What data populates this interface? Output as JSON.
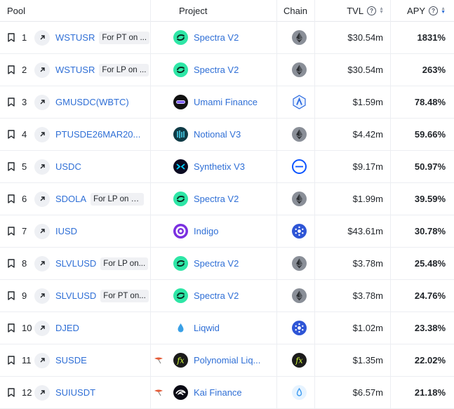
{
  "columns": {
    "pool": "Pool",
    "project": "Project",
    "chain": "Chain",
    "tvl": "TVL",
    "apy": "APY"
  },
  "icons": {
    "help": "question-circle-icon",
    "sort": "sort-arrows-icon",
    "bookmark": "bookmark-icon",
    "open": "arrow-up-right-icon"
  },
  "rows": [
    {
      "idx": "1",
      "symbol": "WSTUSR",
      "tag": "For PT on ...",
      "project": "Spectra V2",
      "project_icon": "spectra",
      "chain": "ethereum",
      "tvl": "$30.54m",
      "apy": "1831%",
      "kite": false
    },
    {
      "idx": "2",
      "symbol": "WSTUSR",
      "tag": "For LP on ...",
      "project": "Spectra V2",
      "project_icon": "spectra",
      "chain": "ethereum",
      "tvl": "$30.54m",
      "apy": "263%",
      "kite": false
    },
    {
      "idx": "3",
      "symbol": "GMUSDC(WBTC)",
      "tag": "",
      "project": "Umami Finance",
      "project_icon": "umami",
      "chain": "arbitrum",
      "tvl": "$1.59m",
      "apy": "78.48%",
      "kite": false
    },
    {
      "idx": "4",
      "symbol": "PTUSDE26MAR20...",
      "tag": "",
      "project": "Notional V3",
      "project_icon": "notional",
      "chain": "ethereum",
      "tvl": "$4.42m",
      "apy": "59.66%",
      "kite": false
    },
    {
      "idx": "5",
      "symbol": "USDC",
      "tag": "",
      "project": "Synthetix V3",
      "project_icon": "synthetix",
      "chain": "base",
      "tvl": "$9.17m",
      "apy": "50.97%",
      "kite": false
    },
    {
      "idx": "6",
      "symbol": "SDOLA",
      "tag": "For LP on In...",
      "project": "Spectra V2",
      "project_icon": "spectra",
      "chain": "ethereum",
      "tvl": "$1.99m",
      "apy": "39.59%",
      "kite": false
    },
    {
      "idx": "7",
      "symbol": "IUSD",
      "tag": "",
      "project": "Indigo",
      "project_icon": "indigo",
      "chain": "cardano",
      "tvl": "$43.61m",
      "apy": "30.78%",
      "kite": false
    },
    {
      "idx": "8",
      "symbol": "SLVLUSD",
      "tag": "For LP on...",
      "project": "Spectra V2",
      "project_icon": "spectra",
      "chain": "ethereum",
      "tvl": "$3.78m",
      "apy": "25.48%",
      "kite": false
    },
    {
      "idx": "9",
      "symbol": "SLVLUSD",
      "tag": "For PT on...",
      "project": "Spectra V2",
      "project_icon": "spectra",
      "chain": "ethereum",
      "tvl": "$3.78m",
      "apy": "24.76%",
      "kite": false
    },
    {
      "idx": "10",
      "symbol": "DJED",
      "tag": "",
      "project": "Liqwid",
      "project_icon": "liqwid",
      "chain": "cardano",
      "tvl": "$1.02m",
      "apy": "23.38%",
      "kite": false
    },
    {
      "idx": "11",
      "symbol": "SUSDE",
      "tag": "",
      "project": "Polynomial Liq...",
      "project_icon": "polynomial",
      "chain": "polynomial",
      "tvl": "$1.35m",
      "apy": "22.02%",
      "kite": true
    },
    {
      "idx": "12",
      "symbol": "SUIUSDT",
      "tag": "",
      "project": "Kai Finance",
      "project_icon": "kai",
      "chain": "sui",
      "tvl": "$6.57m",
      "apy": "21.18%",
      "kite": true
    }
  ]
}
